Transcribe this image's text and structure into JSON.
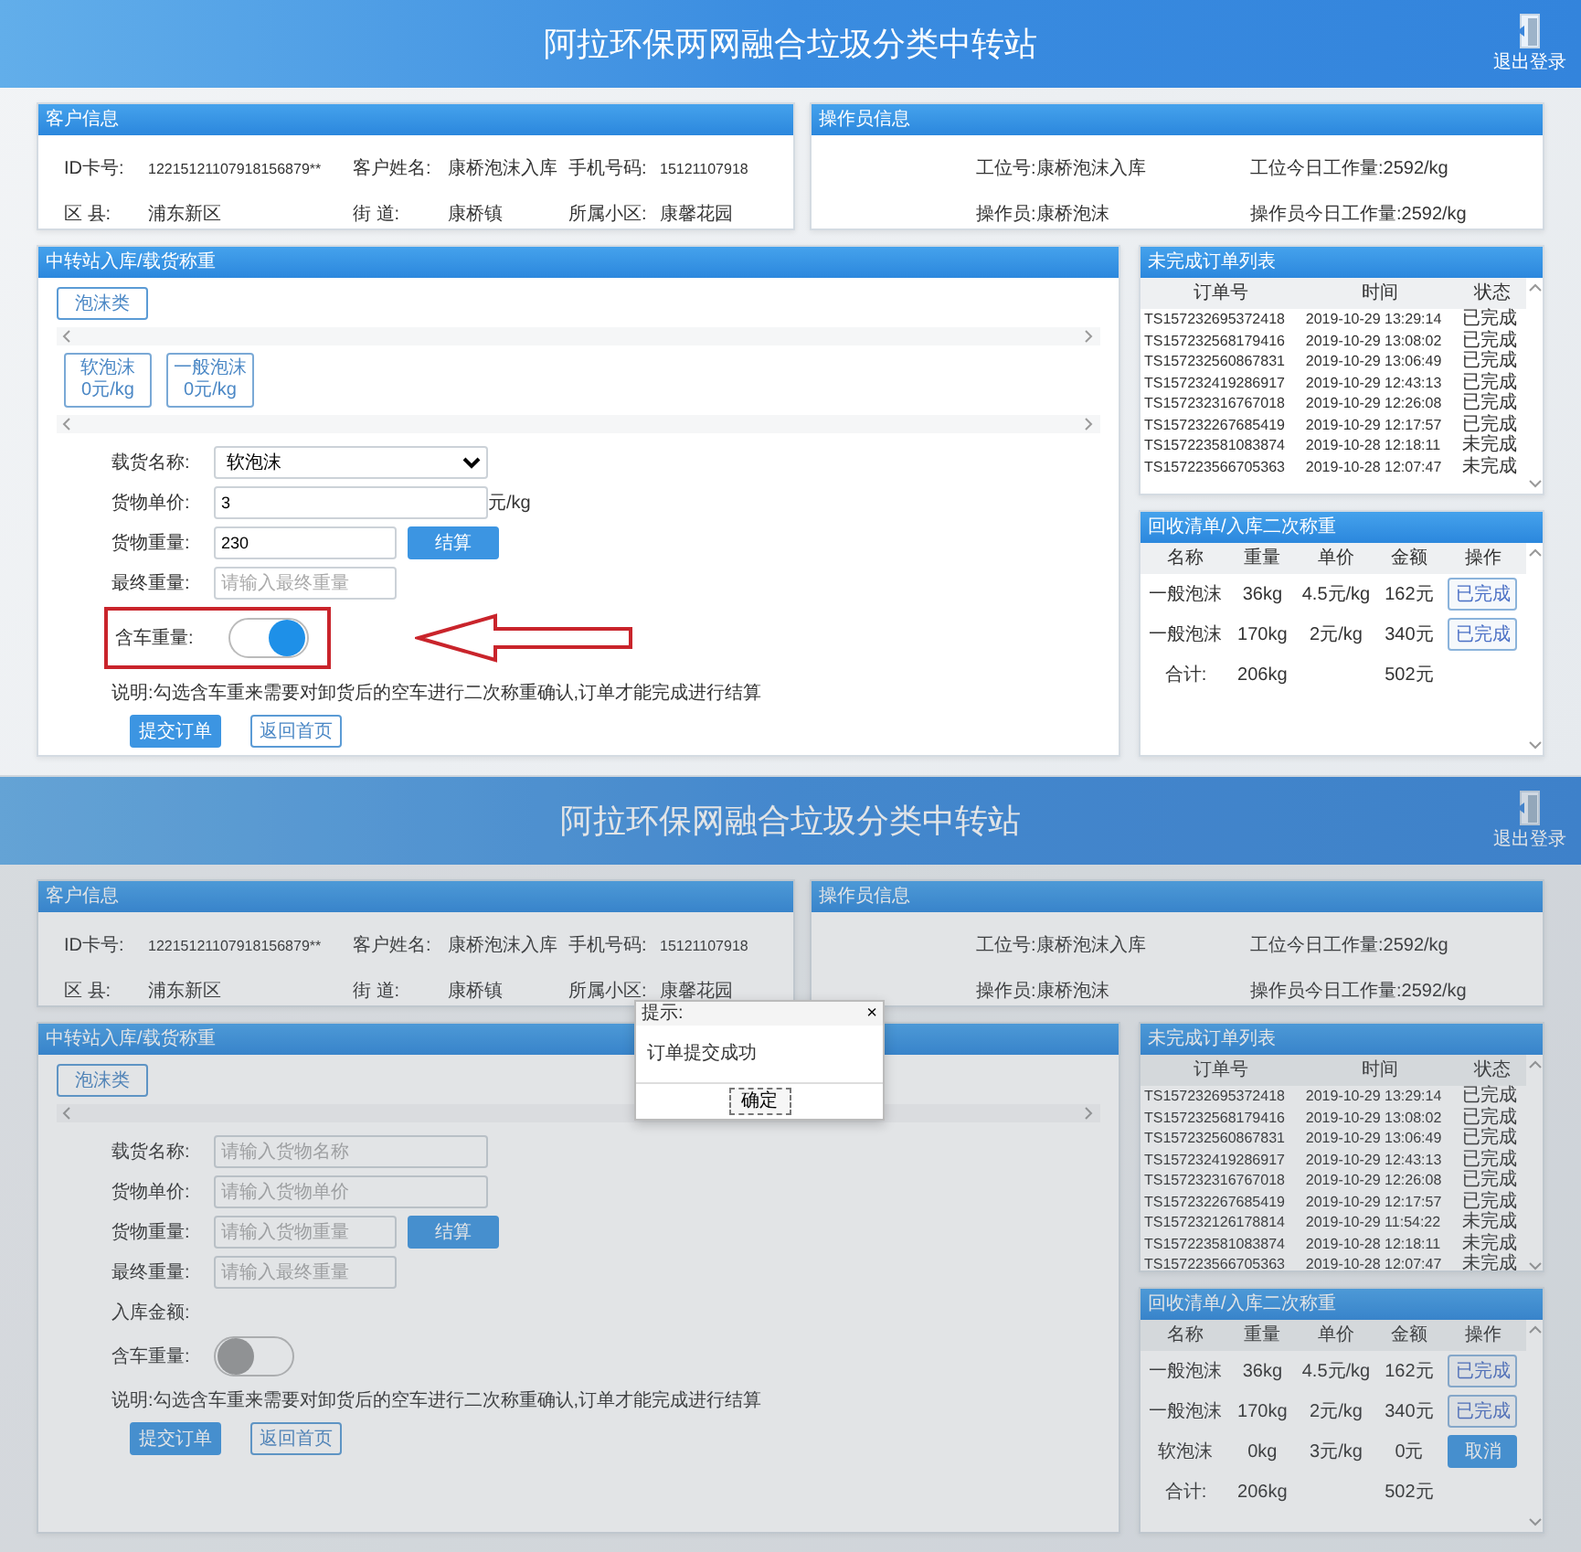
{
  "screens": [
    {
      "header": {
        "title": "阿拉环保两网融合垃圾分类中转站",
        "logout": "退出登录"
      },
      "customer": {
        "title": "客户信息",
        "fields": [
          {
            "label": "ID卡号:",
            "value": "12215121107918156879**"
          },
          {
            "label": "客户姓名:",
            "value": "康桥泡沫入库"
          },
          {
            "label": "手机号码:",
            "value": "15121107918"
          },
          {
            "label": "区 县:",
            "value": "浦东新区"
          },
          {
            "label": "街 道:",
            "value": "康桥镇"
          },
          {
            "label": "所属小区:",
            "value": "康馨花园"
          }
        ]
      },
      "operator": {
        "title": "操作员信息",
        "fields": [
          "工位号:康桥泡沫入库",
          "工位今日工作量:2592/kg",
          "操作员:康桥泡沫",
          "操作员今日工作量:2592/kg"
        ]
      },
      "weighing": {
        "title": "中转站入库/载货称重",
        "category": "泡沫类",
        "goods": [
          {
            "name": "软泡沫",
            "price": "0元/kg"
          },
          {
            "name": "一般泡沫",
            "price": "0元/kg"
          }
        ],
        "form": [
          {
            "kind": "select",
            "label": "载货名称:",
            "value": "软泡沫"
          },
          {
            "kind": "input",
            "label": "货物单价:",
            "value": "3",
            "unit": "元/kg"
          },
          {
            "kind": "input",
            "label": "货物重量:",
            "value": "230",
            "button": "结算"
          },
          {
            "kind": "input",
            "label": "最终重量:",
            "placeholder": "请输入最终重量"
          },
          {
            "kind": "toggle",
            "label": "含车重量:",
            "on": true,
            "highlighted": true
          }
        ],
        "note": "说明:勾选含车重来需要对卸货后的空车进行二次称重确认,订单才能完成进行结算",
        "buttons": [
          {
            "label": "提交订单",
            "kind": "primary"
          },
          {
            "label": "返回首页",
            "kind": "outline"
          }
        ]
      },
      "orders": {
        "title": "未完成订单列表",
        "columns": [
          "订单号",
          "时间",
          "状态"
        ],
        "rows": [
          [
            "TS157232695372418",
            "2019-10-29 13:29:14",
            "已完成"
          ],
          [
            "TS157232568179416",
            "2019-10-29 13:08:02",
            "已完成"
          ],
          [
            "TS157232560867831",
            "2019-10-29 13:06:49",
            "已完成"
          ],
          [
            "TS157232419286917",
            "2019-10-29 12:43:13",
            "已完成"
          ],
          [
            "TS157232316767018",
            "2019-10-29 12:26:08",
            "已完成"
          ],
          [
            "TS157232267685419",
            "2019-10-29 12:17:57",
            "已完成"
          ],
          [
            "TS157223581083874",
            "2019-10-28 12:18:11",
            "未完成"
          ],
          [
            "TS157223566705363",
            "2019-10-28 12:07:47",
            "未完成"
          ]
        ]
      },
      "recycle": {
        "title": "回收清单/入库二次称重",
        "columns": [
          "名称",
          "重量",
          "单价",
          "金额",
          "操作"
        ],
        "rows": [
          {
            "cells": [
              "一般泡沫",
              "36kg",
              "4.5元/kg",
              "162元"
            ],
            "action": "已完成",
            "kind": "done"
          },
          {
            "cells": [
              "一般泡沫",
              "170kg",
              "2元/kg",
              "340元"
            ],
            "action": "已完成",
            "kind": "done"
          }
        ],
        "total": {
          "label": "合计:",
          "weight": "206kg",
          "amount": "502元"
        }
      }
    },
    {
      "header": {
        "title": "阿拉环保网融合垃圾分类中转站",
        "logout": "退出登录"
      },
      "customer": {
        "title": "客户信息",
        "fields": [
          {
            "label": "ID卡号:",
            "value": "12215121107918156879**"
          },
          {
            "label": "客户姓名:",
            "value": "康桥泡沫入库"
          },
          {
            "label": "手机号码:",
            "value": "15121107918"
          },
          {
            "label": "区 县:",
            "value": "浦东新区"
          },
          {
            "label": "街 道:",
            "value": "康桥镇"
          },
          {
            "label": "所属小区:",
            "value": "康馨花园"
          }
        ]
      },
      "operator": {
        "title": "操作员信息",
        "fields": [
          "工位号:康桥泡沫入库",
          "工位今日工作量:2592/kg",
          "操作员:康桥泡沫",
          "操作员今日工作量:2592/kg"
        ]
      },
      "weighing": {
        "title": "中转站入库/载货称重",
        "category": "泡沫类",
        "form": [
          {
            "kind": "input",
            "label": "载货名称:",
            "placeholder": "请输入货物名称"
          },
          {
            "kind": "input",
            "label": "货物单价:",
            "placeholder": "请输入货物单价"
          },
          {
            "kind": "input",
            "label": "货物重量:",
            "placeholder": "请输入货物重量",
            "button": "结算"
          },
          {
            "kind": "input",
            "label": "最终重量:",
            "placeholder": "请输入最终重量"
          },
          {
            "kind": "static",
            "label": "入库金额:"
          },
          {
            "kind": "toggle",
            "label": "含车重量:",
            "on": false,
            "highlighted": false
          }
        ],
        "note": "说明:勾选含车重来需要对卸货后的空车进行二次称重确认,订单才能完成进行结算",
        "buttons": [
          {
            "label": "提交订单",
            "kind": "primary"
          },
          {
            "label": "返回首页",
            "kind": "outline"
          }
        ]
      },
      "orders": {
        "title": "未完成订单列表",
        "columns": [
          "订单号",
          "时间",
          "状态"
        ],
        "rows": [
          [
            "TS157232695372418",
            "2019-10-29 13:29:14",
            "已完成"
          ],
          [
            "TS157232568179416",
            "2019-10-29 13:08:02",
            "已完成"
          ],
          [
            "TS157232560867831",
            "2019-10-29 13:06:49",
            "已完成"
          ],
          [
            "TS157232419286917",
            "2019-10-29 12:43:13",
            "已完成"
          ],
          [
            "TS157232316767018",
            "2019-10-29 12:26:08",
            "已完成"
          ],
          [
            "TS157232267685419",
            "2019-10-29 12:17:57",
            "已完成"
          ],
          [
            "TS157232126178814",
            "2019-10-29 11:54:22",
            "未完成"
          ],
          [
            "TS157223581083874",
            "2019-10-28 12:18:11",
            "未完成"
          ],
          [
            "TS157223566705363",
            "2019-10-28 12:07:47",
            "未完成"
          ]
        ]
      },
      "recycle": {
        "title": "回收清单/入库二次称重",
        "columns": [
          "名称",
          "重量",
          "单价",
          "金额",
          "操作"
        ],
        "rows": [
          {
            "cells": [
              "一般泡沫",
              "36kg",
              "4.5元/kg",
              "162元"
            ],
            "action": "已完成",
            "kind": "done"
          },
          {
            "cells": [
              "一般泡沫",
              "170kg",
              "2元/kg",
              "340元"
            ],
            "action": "已完成",
            "kind": "done"
          },
          {
            "cells": [
              "软泡沫",
              "0kg",
              "3元/kg",
              "0元"
            ],
            "action": "取消",
            "kind": "cancel"
          }
        ],
        "total": {
          "label": "合计:",
          "weight": "206kg",
          "amount": "502元"
        }
      },
      "dialog": {
        "title": "提示:",
        "close": "×",
        "message": "订单提交成功",
        "button": "确定"
      }
    }
  ]
}
